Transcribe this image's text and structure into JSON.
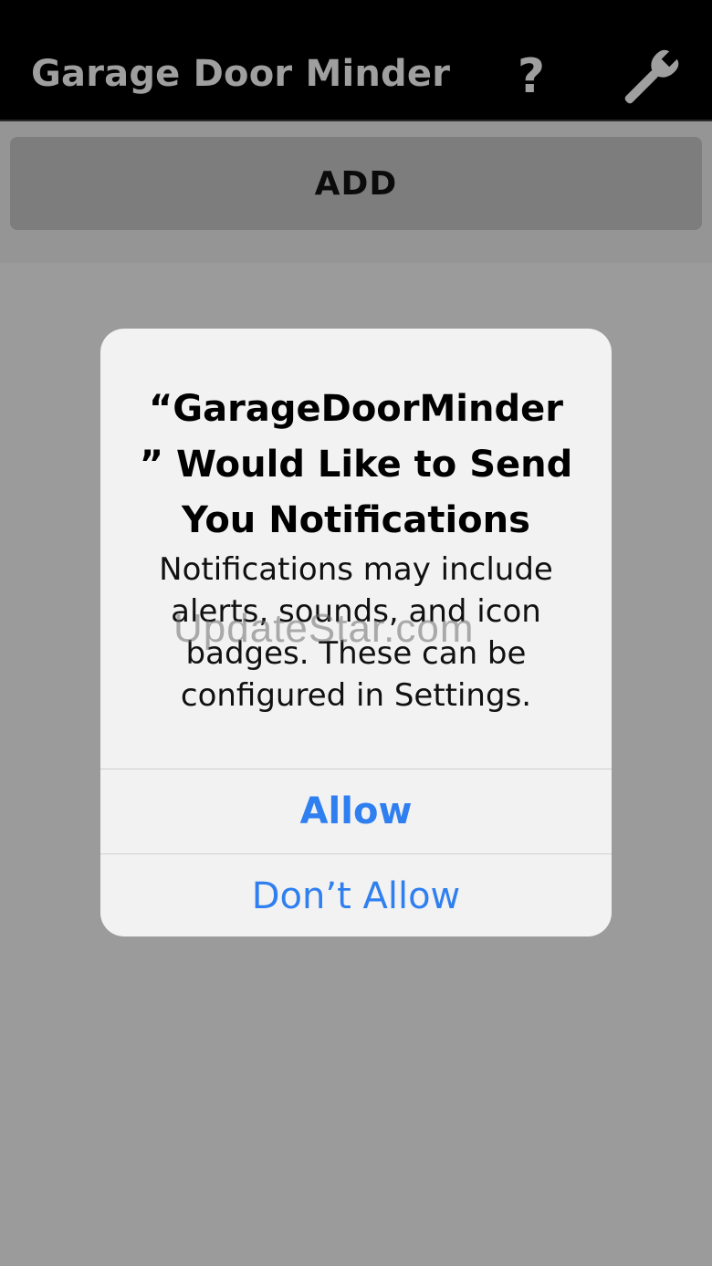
{
  "app_bar": {
    "title": "Garage Door Minder",
    "help_label": "?",
    "help_icon": "question-icon",
    "settings_icon": "wrench-icon"
  },
  "toolbar": {
    "add_label": "ADD"
  },
  "alert": {
    "title": "“GarageDoorMinder\n” Would Like to Send\nYou Notifications",
    "message": "Notifications may include\nalerts, sounds, and icon\nbadges. These can be\nconfigured in Settings.",
    "allow_label": "Allow",
    "dont_allow_label": "Don’t Allow"
  },
  "watermark": "UpdateStar.com",
  "colors": {
    "app_bar_background": "#000000",
    "app_bar_text": "#9f9f9f",
    "background": "#9b9b9b",
    "add_button": "#7d7d7d",
    "alert_background": "#f2f2f2",
    "action_blue": "#2f7ff0"
  }
}
